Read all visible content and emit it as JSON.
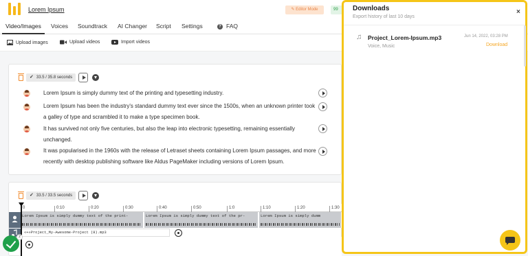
{
  "header": {
    "project_title": "Lorem Ipsum",
    "editor_mode": "✎ Editor Mode",
    "credits": "99"
  },
  "tabs": [
    {
      "label": "Video/Images"
    },
    {
      "label": "Voices"
    },
    {
      "label": "Soundtrack"
    },
    {
      "label": "AI Changer"
    },
    {
      "label": "Script"
    },
    {
      "label": "Settings"
    },
    {
      "label": "FAQ"
    }
  ],
  "subbar": {
    "upload_images": "Upload images",
    "upload_videos": "Upload videos",
    "import_videos": "Import videos"
  },
  "card1": {
    "duration": "33.5 / 35.8 seconds",
    "paragraphs": [
      "Lorem Ipsum is simply dummy text of the printing and typesetting industry.",
      "Lorem Ipsum has been the industry's standard dummy text ever since the 1500s, when an unknown printer took a galley of type and scrambled it to make a type specimen book.",
      "It has survived not only five centuries, but also the leap into electronic typesetting, remaining essentially unchanged.",
      "It was popularised in the 1960s with the release of Letraset sheets containing Lorem Ipsum passages, and more recently with desktop publishing software like Aldus PageMaker including versions of Lorem Ipsum."
    ]
  },
  "card2": {
    "duration": "33.5 / 33.5 seconds"
  },
  "timeline": {
    "ticks": [
      "0",
      "0:10",
      "0:20",
      "0:30",
      "0:40",
      "0:50",
      "1:0",
      "1:10",
      "1:20",
      "1:30"
    ],
    "clips": [
      "Lorem Ipsum is simply dummy text of the print-",
      "Lorem Ipsum is simply dummy text of the pr-",
      "Lorem Ipsum is simply dumm"
    ],
    "audio_track": "«+»Project_My-Awesome-Project (8).mp3",
    "badge_count": "2"
  },
  "downloads": {
    "title": "Downloads",
    "subtitle": "Export history of last 10 days",
    "close": "×",
    "item": {
      "name": "Project_Lorem-Ipsum.mp3",
      "tags": "Voice, Music",
      "date": "Jun 14, 2022, 03:28 PM",
      "download_label": "Download"
    }
  },
  "colors": {
    "accent": "#f5c518",
    "logo": "#f6b81a",
    "download_link": "#f5a623",
    "success": "#1fa04a"
  }
}
